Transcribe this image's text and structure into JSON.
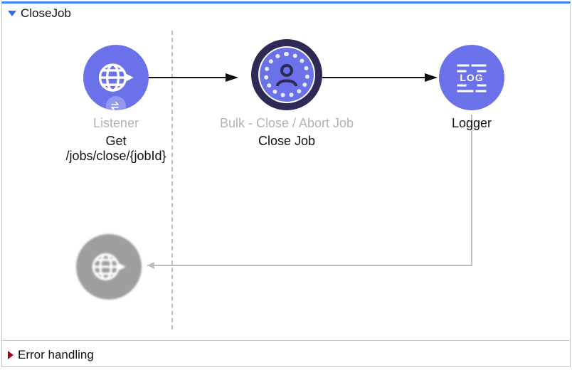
{
  "flow": {
    "title": "CloseJob",
    "errorSection": "Error handling",
    "nodes": {
      "listener": {
        "type": "Listener",
        "name": "Get /jobs/close/{jobId}"
      },
      "operation": {
        "type": "Bulk - Close / Abort Job",
        "name": "Close Job"
      },
      "logger": {
        "type": "",
        "name": "Logger"
      }
    }
  }
}
